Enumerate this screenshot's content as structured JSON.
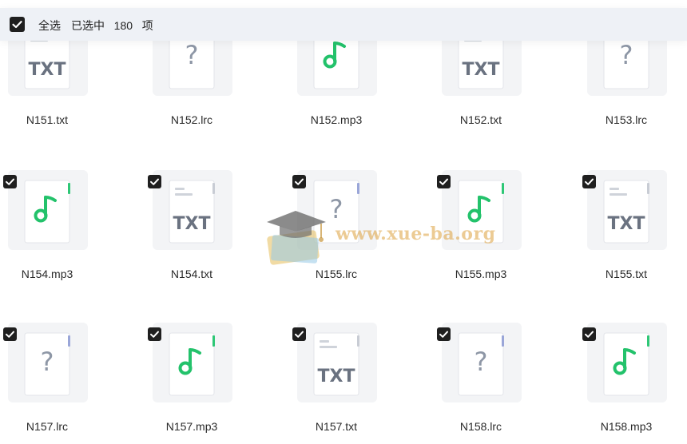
{
  "toolbar": {
    "select_all_label": "全选",
    "selected_prefix": "已选中",
    "selected_count": "180",
    "selected_suffix": "项"
  },
  "watermark": {
    "text": "www.xue-ba.org"
  },
  "files": [
    {
      "name": "N151.txt",
      "type": "txt",
      "checked": false
    },
    {
      "name": "N152.lrc",
      "type": "lrc",
      "checked": false
    },
    {
      "name": "N152.mp3",
      "type": "mp3",
      "checked": false
    },
    {
      "name": "N152.txt",
      "type": "txt",
      "checked": false
    },
    {
      "name": "N153.lrc",
      "type": "lrc",
      "checked": false
    },
    {
      "name": "N154.mp3",
      "type": "mp3",
      "checked": true
    },
    {
      "name": "N154.txt",
      "type": "txt",
      "checked": true
    },
    {
      "name": "N155.lrc",
      "type": "lrc",
      "checked": true
    },
    {
      "name": "N155.mp3",
      "type": "mp3",
      "checked": true
    },
    {
      "name": "N155.txt",
      "type": "txt",
      "checked": true
    },
    {
      "name": "N157.lrc",
      "type": "lrc",
      "checked": true
    },
    {
      "name": "N157.mp3",
      "type": "mp3",
      "checked": true
    },
    {
      "name": "N157.txt",
      "type": "txt",
      "checked": true
    },
    {
      "name": "N158.lrc",
      "type": "lrc",
      "checked": true
    },
    {
      "name": "N158.mp3",
      "type": "mp3",
      "checked": true
    }
  ],
  "icons": {
    "txt": {
      "label": "TXT",
      "text_color": "#6a7280",
      "accent": "#c8ccd4"
    },
    "lrc": {
      "glyph": "?",
      "glyph_color": "#8e97a6",
      "accent": "#9aa6d8"
    },
    "mp3": {
      "glyph_color": "#23c26b",
      "accent": "#2ec776"
    }
  }
}
